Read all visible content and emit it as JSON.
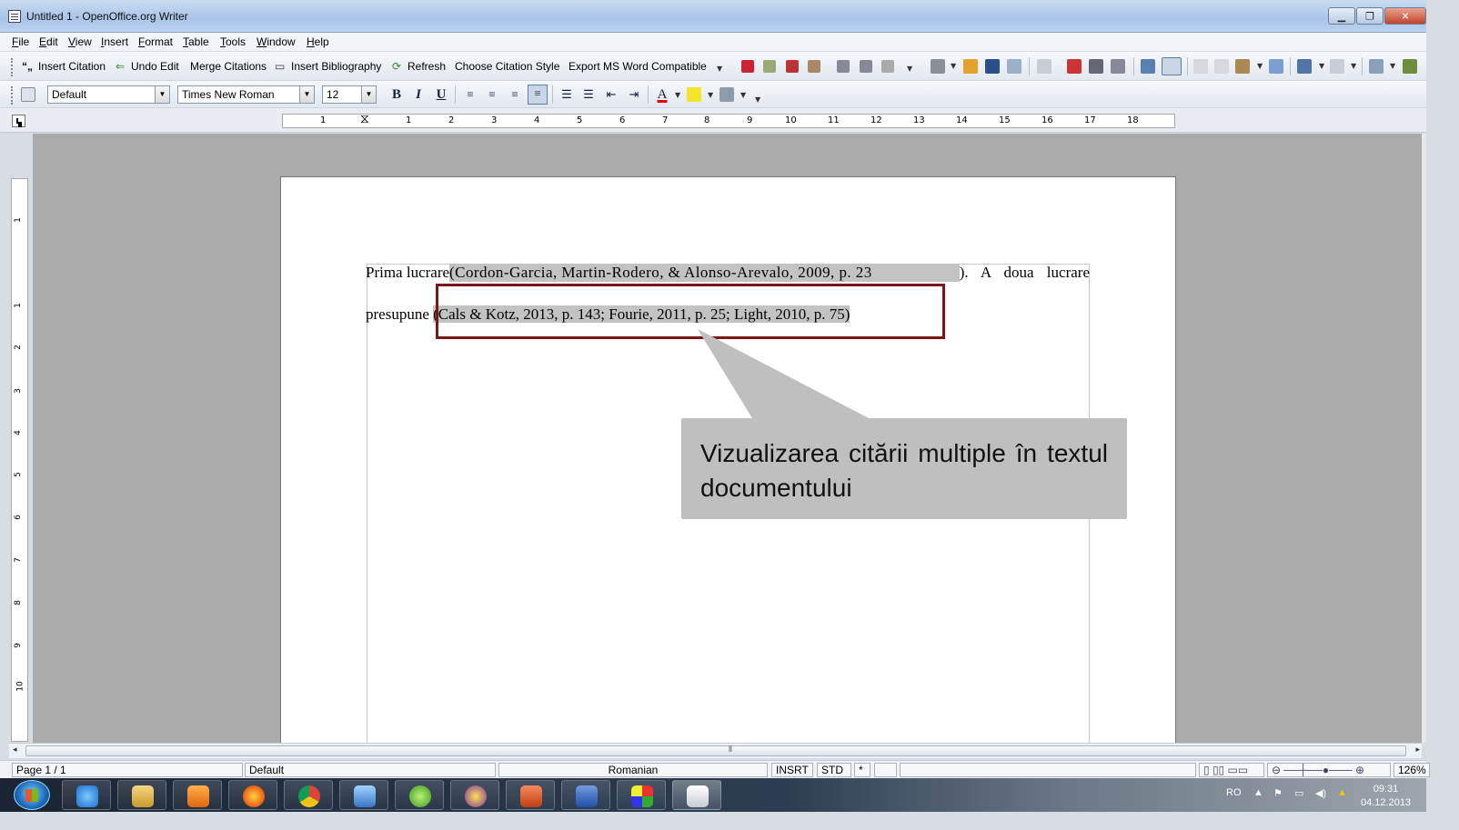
{
  "window": {
    "title": "Untitled 1 - OpenOffice.org Writer"
  },
  "menu": [
    "File",
    "Edit",
    "View",
    "Insert",
    "Format",
    "Table",
    "Tools",
    "Window",
    "Help"
  ],
  "citation_toolbar": {
    "insert_citation": "Insert Citation",
    "undo_edit": "Undo Edit",
    "merge_citations": "Merge Citations",
    "insert_bibliography": "Insert Bibliography",
    "refresh": "Refresh",
    "choose_style": "Choose Citation Style",
    "export_word": "Export MS Word Compatible"
  },
  "formatting": {
    "paragraph_style": "Default",
    "font_name": "Times New Roman",
    "font_size": "12"
  },
  "ruler": {
    "h_numbers": [
      "1",
      "1",
      "2",
      "3",
      "4",
      "5",
      "6",
      "7",
      "8",
      "9",
      "10",
      "11",
      "12",
      "13",
      "14",
      "15",
      "16",
      "17",
      "18"
    ],
    "v_numbers": [
      "1",
      "1",
      "2",
      "3",
      "4",
      "5",
      "6",
      "7",
      "8",
      "9",
      "10"
    ]
  },
  "document": {
    "line1_before": "Prima lucrare",
    "line1_citation": "(Cordon-Garcia, Martin-Rodero, & Alonso-Arevalo, 2009, p. 23",
    "line1_after": "). A doua lucrare",
    "line2_before": "presupune ",
    "line2_citation": "(Cals & Kotz, 2013, p. 143; Fourie, 2011, p. 25; Light, 2010, p. 75)"
  },
  "callout": {
    "text": "Vizualizarea citării multiple în textul documentului"
  },
  "statusbar": {
    "page": "Page 1 / 1",
    "style": "Default",
    "language": "Romanian",
    "insert_mode": "INSRT",
    "selection_mode": "STD",
    "modified": "*",
    "zoom": "126%"
  },
  "taskbar": {
    "language": "RO",
    "time": "09:31",
    "date": "04.12.2013"
  },
  "colors": {
    "highlight": "#c3c3c3",
    "redbox": "#7a1717",
    "callout": "#bfbfbf",
    "workspace": "#ababab"
  }
}
